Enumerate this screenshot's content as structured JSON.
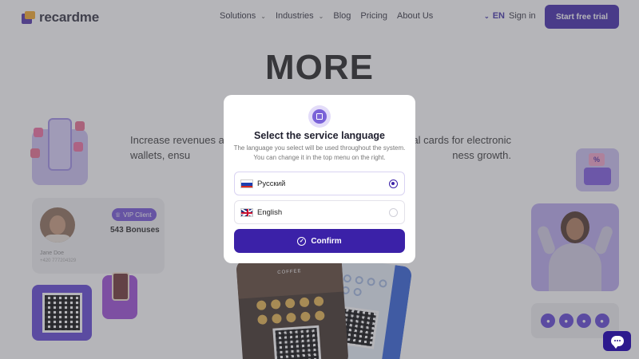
{
  "brand": {
    "name": "recardme"
  },
  "nav": {
    "items": [
      {
        "label": "Solutions",
        "has_dropdown": true
      },
      {
        "label": "Industries",
        "has_dropdown": true
      },
      {
        "label": "Blog",
        "has_dropdown": false
      },
      {
        "label": "Pricing",
        "has_dropdown": false
      },
      {
        "label": "About Us",
        "has_dropdown": false
      }
    ],
    "language": "EN",
    "sign_in": "Sign in",
    "cta": "Start free trial"
  },
  "hero": {
    "title": "MORE",
    "subtitle_left": "Increase revenues and wallets, ensu",
    "subtitle_right": "al cards for electronic ness growth."
  },
  "vip_card": {
    "badge": "VIP Client",
    "bonuses": "543 Bonuses",
    "name": "Jane Doe",
    "phone": "+420 777204329"
  },
  "bag_card": {
    "symbol": "%"
  },
  "coffee_phone": {
    "brand": "COFFEE"
  },
  "modal": {
    "title": "Select the service language",
    "description": "The language you select will be used throughout the system. You can change it in the top menu on the right.",
    "options": [
      {
        "label": "Русский",
        "flag": "ru-flag-icon",
        "selected": true
      },
      {
        "label": "English",
        "flag": "uk-flag-icon",
        "selected": false
      }
    ],
    "confirm_label": "Confirm"
  },
  "colors": {
    "accent": "#3b21a8",
    "overlay": "rgba(90, 90, 100, 0.45)",
    "card_purple": "#cbbff3"
  },
  "icons": {
    "modal": "translate-icon",
    "chat": "chat-bubble-icon",
    "confirm": "check-circle-icon"
  }
}
